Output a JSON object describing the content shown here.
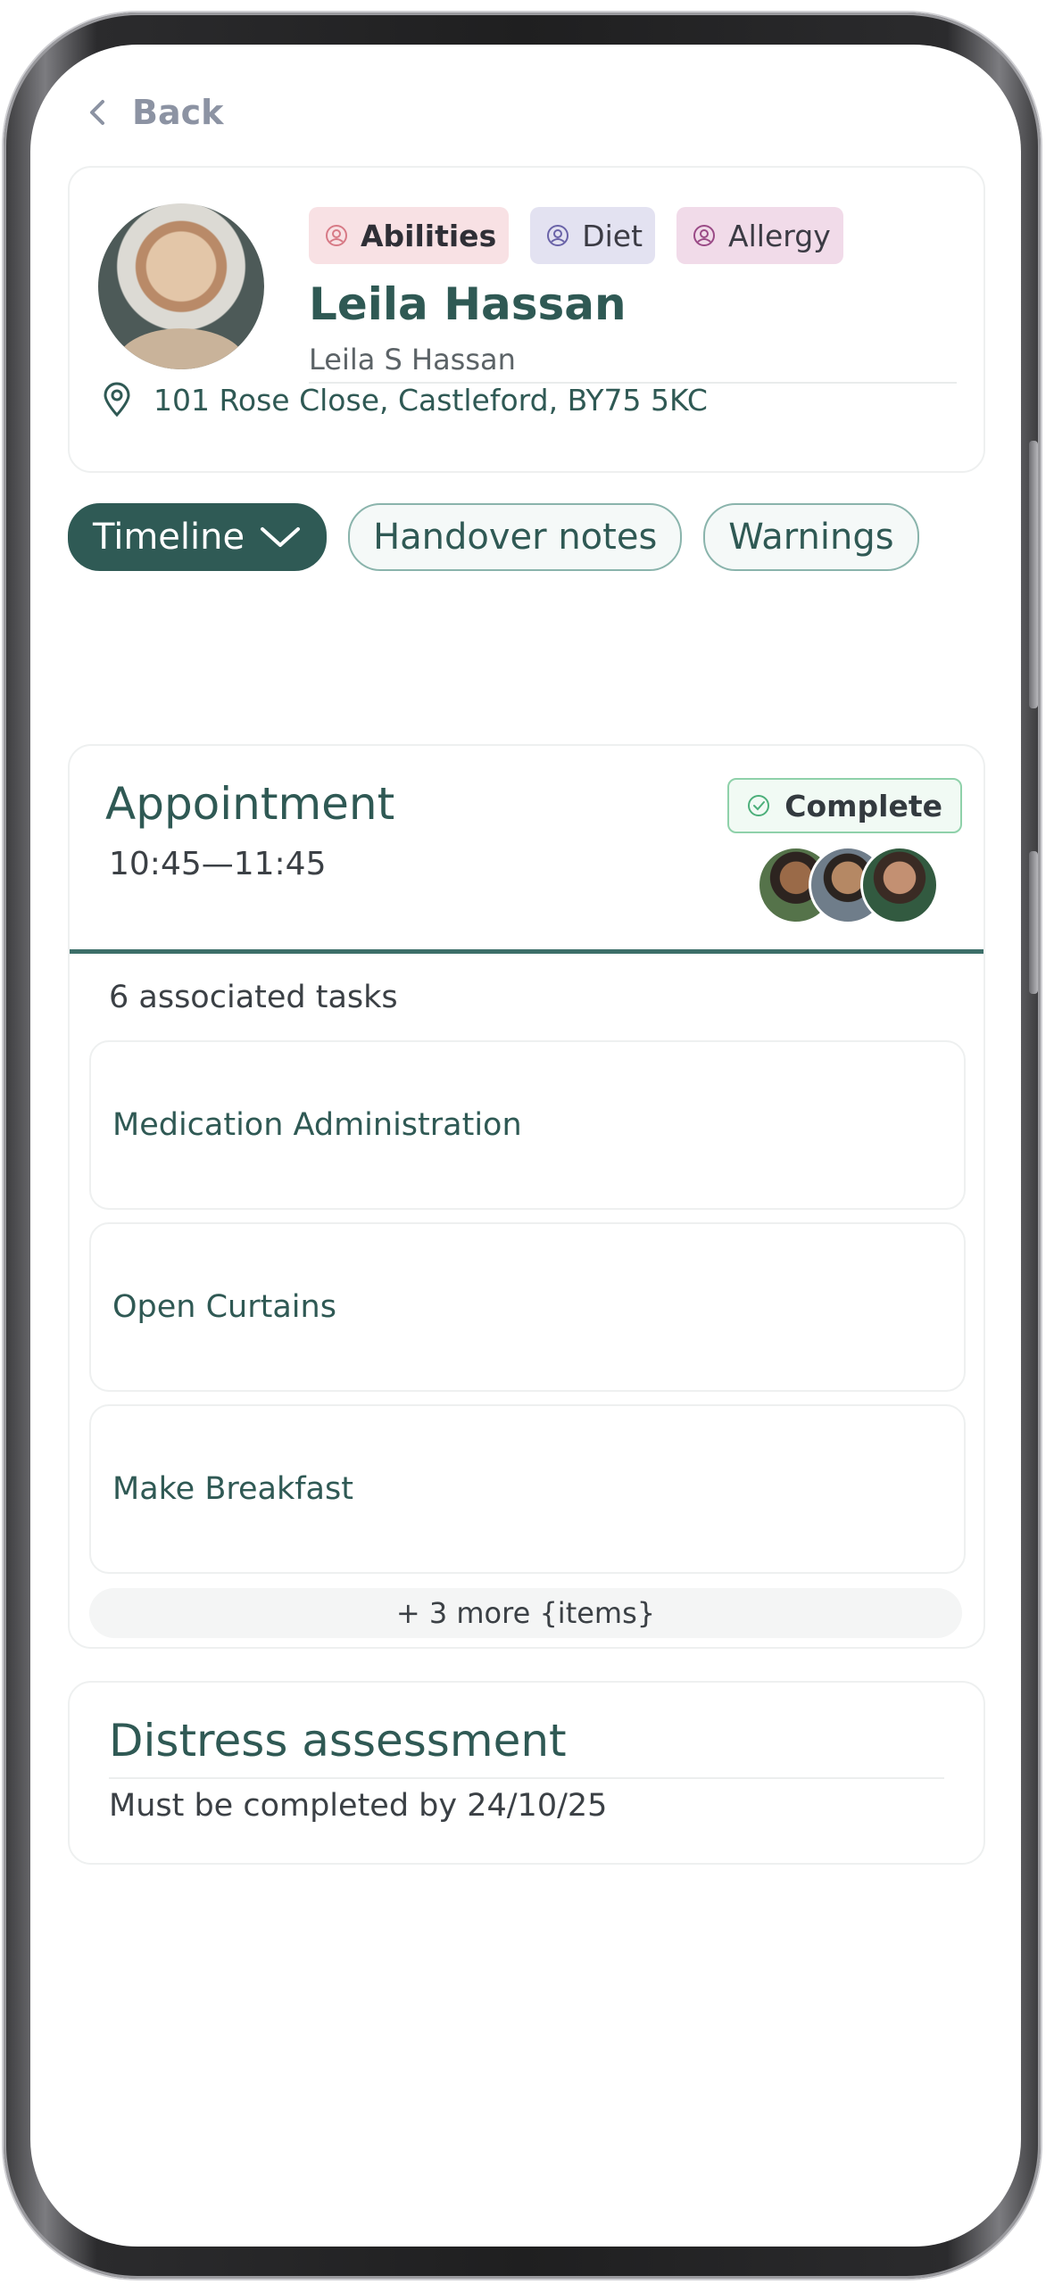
{
  "nav": {
    "back_label": "Back"
  },
  "client": {
    "tags": [
      {
        "label": "Abilities",
        "color": "#f8e1e4",
        "icon": "person-circle-icon"
      },
      {
        "label": "Diet",
        "color": "#e3e2f1",
        "icon": "person-circle-icon"
      },
      {
        "label": "Allergy",
        "color": "#f1dbe9",
        "icon": "person-circle-icon"
      }
    ],
    "name": "Leila Hassan",
    "full_name": "Leila S Hassan",
    "address": "101 Rose Close, Castleford, BY75 5KC"
  },
  "tabs": [
    {
      "label": "Timeline",
      "active": true
    },
    {
      "label": "Handover notes",
      "active": false
    },
    {
      "label": "Warnings",
      "active": false
    }
  ],
  "appointment": {
    "title": "Appointment",
    "time": "10:45—11:45",
    "status": "Complete",
    "status_color": "#8fd1aa",
    "tasks_summary": "6 associated tasks",
    "tasks": [
      {
        "label": "Medication Administration"
      },
      {
        "label": "Open Curtains"
      },
      {
        "label": "Make Breakfast"
      }
    ],
    "more_label": "+ 3 more {items}"
  },
  "assessment": {
    "title": "Distress assessment",
    "due": "Must be completed by 24/10/25"
  },
  "colors": {
    "brand": "#2f5a55",
    "accent_rule": "#3d6f69"
  }
}
